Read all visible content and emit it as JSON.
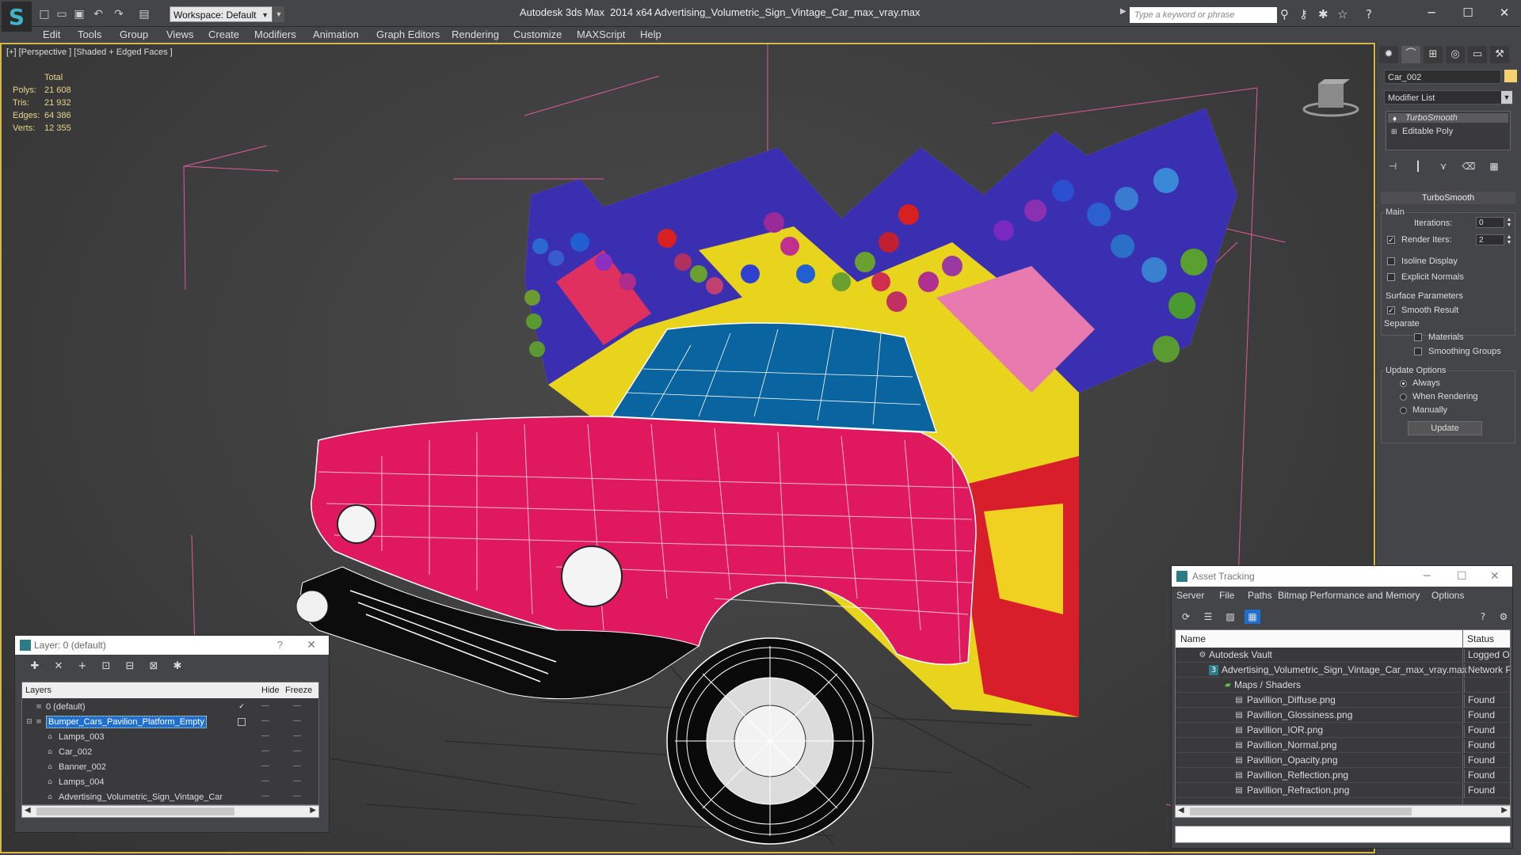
{
  "titlebar": {
    "app_title": "Autodesk 3ds Max  2014 x64",
    "file_title": "Advertising_Volumetric_Sign_Vintage_Car_max_vray.max",
    "workspace": "Workspace: Default",
    "search_placeholder": "Type a keyword or phrase"
  },
  "menu": [
    "Edit",
    "Tools",
    "Group",
    "Views",
    "Create",
    "Modifiers",
    "Animation",
    "Graph Editors",
    "Rendering",
    "Customize",
    "MAXScript",
    "Help"
  ],
  "viewport": {
    "label": "[+] [Perspective ] [Shaded + Edged Faces ]",
    "stats": {
      "header": "Total",
      "rows": [
        {
          "k": "Polys:",
          "v": "21 608"
        },
        {
          "k": "Tris:",
          "v": "21 932"
        },
        {
          "k": "Edges:",
          "v": "64 386"
        },
        {
          "k": "Verts:",
          "v": "12 355"
        }
      ]
    }
  },
  "command_panel": {
    "object_name": "Car_002",
    "object_color": "#f5d070",
    "modifier_list": "Modifier List",
    "stack": [
      "TurboSmooth",
      "Editable Poly"
    ],
    "rollout": "TurboSmooth",
    "main_group": "Main",
    "iterations_label": "Iterations:",
    "iterations_value": "0",
    "render_iters_label": "Render Iters:",
    "render_iters_value": "2",
    "isoline_display": "Isoline Display",
    "explicit_normals": "Explicit Normals",
    "surface_params": "Surface Parameters",
    "smooth_result": "Smooth Result",
    "separate": "Separate",
    "materials": "Materials",
    "smoothing_groups": "Smoothing Groups",
    "update_options": "Update Options",
    "always": "Always",
    "when_rendering": "When Rendering",
    "manually": "Manually",
    "update_button": "Update"
  },
  "layer_window": {
    "title": "Layer: 0 (default)",
    "help": "?",
    "columns": {
      "layers": "Layers",
      "hide": "Hide",
      "freeze": "Freeze"
    },
    "rows": [
      {
        "name": "0 (default)",
        "indent": 0
      },
      {
        "name": "Bumper_Cars_Pavilion_Platform_Empty",
        "indent": 0
      },
      {
        "name": "Lamps_003",
        "indent": 1
      },
      {
        "name": "Car_002",
        "indent": 1
      },
      {
        "name": "Banner_002",
        "indent": 1
      },
      {
        "name": "Lamps_004",
        "indent": 1
      },
      {
        "name": "Advertising_Volumetric_Sign_Vintage_Car",
        "indent": 1
      }
    ]
  },
  "asset_window": {
    "title": "Asset Tracking",
    "menu": [
      "Server",
      "File",
      "Paths",
      "Bitmap Performance and Memory",
      "Options"
    ],
    "columns": {
      "name": "Name",
      "status": "Status"
    },
    "rows": [
      {
        "name": "Autodesk Vault",
        "status": "Logged Ou"
      },
      {
        "name": "Advertising_Volumetric_Sign_Vintage_Car_max_vray.max",
        "status": "Network P"
      },
      {
        "name": "Maps / Shaders",
        "status": ""
      },
      {
        "name": "Pavillion_Diffuse.png",
        "status": "Found"
      },
      {
        "name": "Pavillion_Glossiness.png",
        "status": "Found"
      },
      {
        "name": "Pavillion_IOR.png",
        "status": "Found"
      },
      {
        "name": "Pavillion_Normal.png",
        "status": "Found"
      },
      {
        "name": "Pavillion_Opacity.png",
        "status": "Found"
      },
      {
        "name": "Pavillion_Reflection.png",
        "status": "Found"
      },
      {
        "name": "Pavillion_Refraction.png",
        "status": "Found"
      }
    ]
  }
}
